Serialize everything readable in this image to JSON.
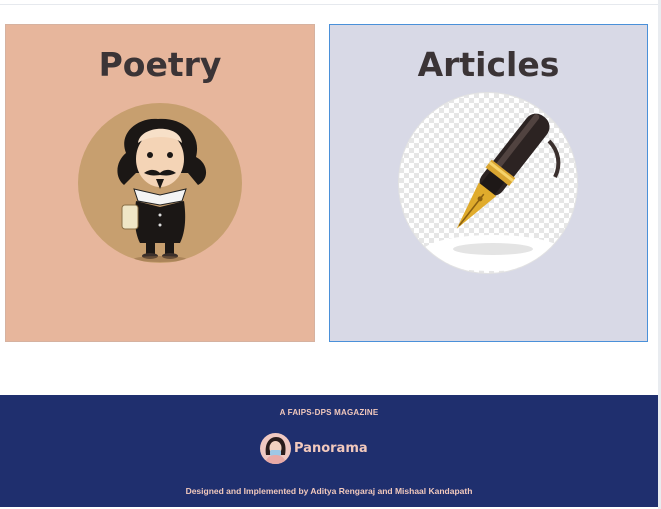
{
  "cards": {
    "poetry": {
      "title": "Poetry",
      "image_icon": "shakespeare-illustration",
      "bg_color": "#e7b69c"
    },
    "articles": {
      "title": "Articles",
      "image_icon": "fountain-pen-illustration",
      "bg_color": "#d8d9e6",
      "border_color": "#4a90d9"
    }
  },
  "footer": {
    "tagline": "A FAIPS-DPS MAGAZINE",
    "brand_name": "Panorama",
    "brand_icon": "panorama-logo-avatar",
    "credit": "Designed and Implemented by Aditya Rengaraj and Mishaal Kandapath",
    "bg_color": "#1f2f6e",
    "text_color": "#f2c9bd"
  }
}
